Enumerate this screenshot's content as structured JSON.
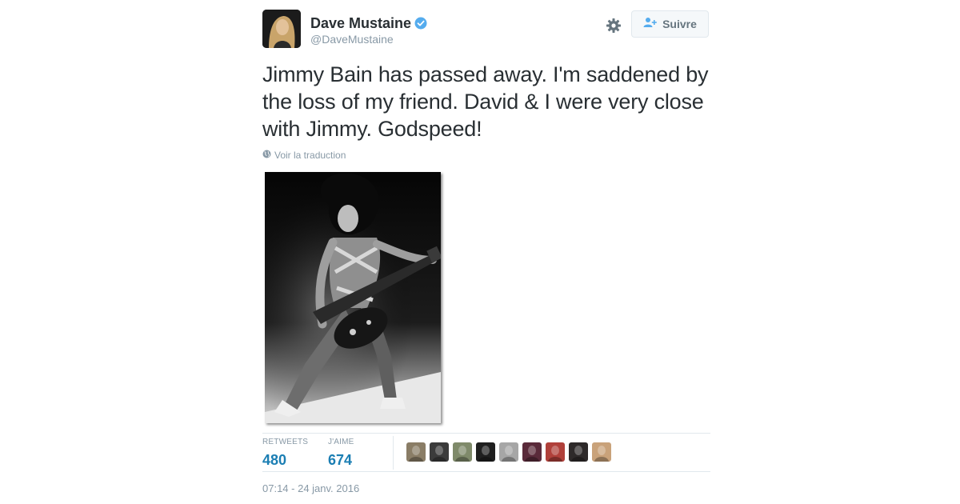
{
  "author": {
    "display_name": "Dave Mustaine",
    "handle": "@DaveMustaine",
    "verified": true,
    "avatar_icon": "profile-photo"
  },
  "actions": {
    "settings_icon": "gear-icon",
    "follow_label": "Suivre",
    "follow_icon": "add-user-icon"
  },
  "tweet": {
    "text": "Jimmy Bain has passed away. I'm saddened by the loss of my friend. David & I were very close with Jimmy. Godspeed!",
    "translate_label": "Voir la traduction",
    "translate_icon": "globe-icon",
    "media_description_icon": "photo"
  },
  "stats": {
    "retweets_label": "RETWEETS",
    "retweets_value": "480",
    "likes_label": "J'AIME",
    "likes_value": "674"
  },
  "likers": [
    {
      "tone": "#8a7d66"
    },
    {
      "tone": "#3b3b3b"
    },
    {
      "tone": "#7f8a6a"
    },
    {
      "tone": "#1f1f1f"
    },
    {
      "tone": "#a6a6a6"
    },
    {
      "tone": "#5a2a3a"
    },
    {
      "tone": "#b0403a"
    },
    {
      "tone": "#2e2a2a"
    },
    {
      "tone": "#c9a27a"
    }
  ],
  "timestamp": "07:14 - 24 janv. 2016",
  "colors": {
    "link_blue": "#1b7eb3",
    "muted_gray": "#8899a6",
    "verified_blue": "#55acee",
    "text": "#292f33"
  }
}
